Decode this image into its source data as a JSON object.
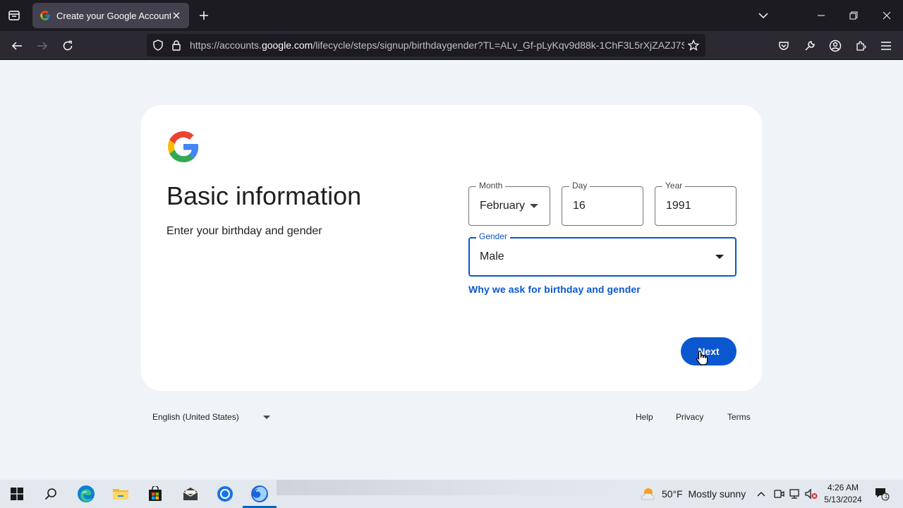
{
  "browser": {
    "tab_title": "Create your Google Account",
    "url_prefix": "https://accounts.",
    "url_domain": "google.com",
    "url_suffix": "/lifecycle/steps/signup/birthdaygender?TL=ALv_Gf-pLyKqv9d88k-1ChF3L5rXjZAZJ7S"
  },
  "page": {
    "heading": "Basic information",
    "subheading": "Enter your birthday and gender",
    "month": {
      "label": "Month",
      "value": "February"
    },
    "day": {
      "label": "Day",
      "value": "16"
    },
    "year": {
      "label": "Year",
      "value": "1991"
    },
    "gender": {
      "label": "Gender",
      "value": "Male"
    },
    "why_link": "Why we ask for birthday and gender",
    "next_label": "Next"
  },
  "footer": {
    "language": "English (United States)",
    "help": "Help",
    "privacy": "Privacy",
    "terms": "Terms"
  },
  "taskbar": {
    "weather_temp": "50°F",
    "weather_desc": "Mostly sunny",
    "time": "4:26 AM",
    "date": "5/13/2024",
    "notification_count": "1"
  },
  "colors": {
    "accent": "#0b57d0",
    "page_bg": "#f0f4f9",
    "chrome_dark": "#1c1b22"
  }
}
